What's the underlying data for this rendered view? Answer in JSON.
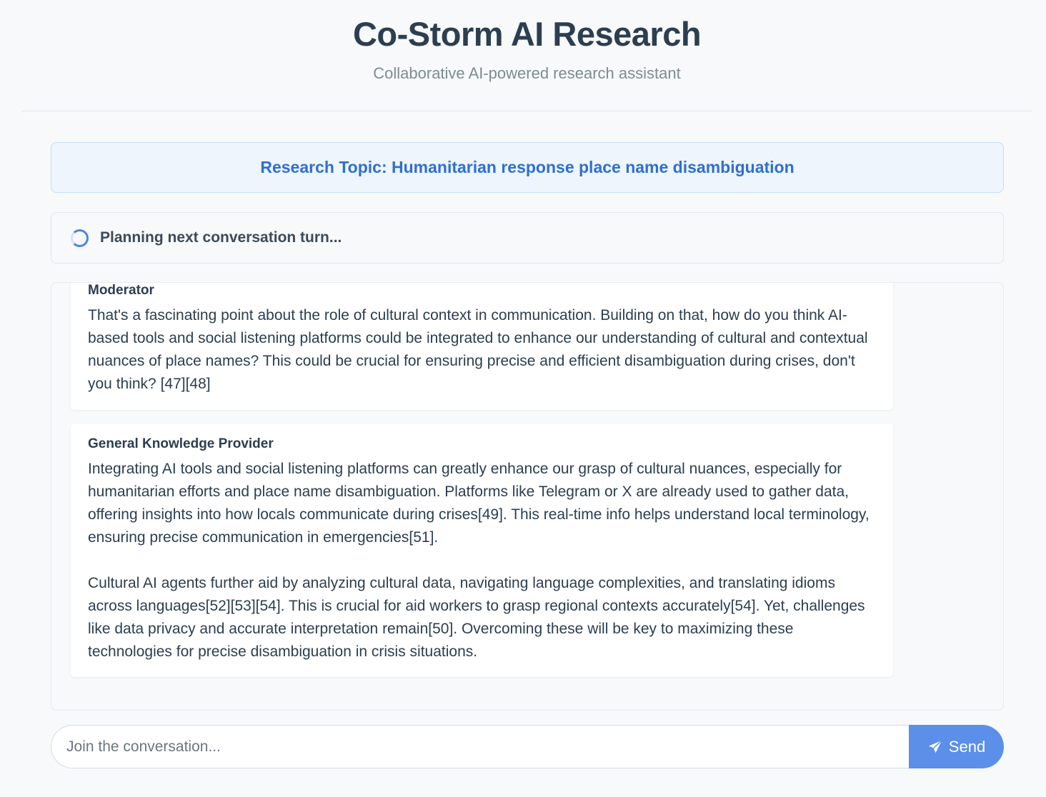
{
  "header": {
    "title": "Co-Storm AI Research",
    "subtitle": "Collaborative AI-powered research assistant"
  },
  "topic": {
    "label": "Research Topic: Humanitarian response place name disambiguation"
  },
  "status": {
    "text": "Planning next conversation turn...",
    "icon": "spinner-icon"
  },
  "messages": [
    {
      "speaker": "Moderator",
      "text": "That's a fascinating point about the role of cultural context in communication. Building on that, how do you think AI-based tools and social listening platforms could be integrated to enhance our understanding of cultural and contextual nuances of place names? This could be crucial for ensuring precise and efficient disambiguation during crises, don't you think? [47][48]"
    },
    {
      "speaker": "General Knowledge Provider",
      "text": "Integrating AI tools and social listening platforms can greatly enhance our grasp of cultural nuances, especially for humanitarian efforts and place name disambiguation. Platforms like Telegram or X are already used to gather data, offering insights into how locals communicate during crises[49]. This real-time info helps understand local terminology, ensuring precise communication in emergencies[51].\n\nCultural AI agents further aid by analyzing cultural data, navigating language complexities, and translating idioms across languages[52][53][54]. This is crucial for aid workers to grasp regional contexts accurately[54]. Yet, challenges like data privacy and accurate interpretation remain[50]. Overcoming these will be key to maximizing these technologies for precise disambiguation in crisis situations."
    }
  ],
  "composer": {
    "placeholder": "Join the conversation...",
    "value": "",
    "send_label": "Send",
    "send_icon": "paper-plane-icon"
  },
  "colors": {
    "accent": "#5b8fea",
    "topic_text": "#2f6fcf",
    "topic_bg": "#eef5fd",
    "page_bg": "#f7f9fb"
  }
}
